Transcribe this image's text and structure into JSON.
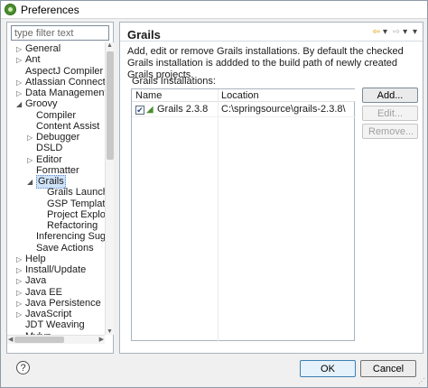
{
  "window": {
    "title": "Preferences",
    "icon": "groovy-green-icon"
  },
  "filter": {
    "placeholder": "type filter text"
  },
  "tree": [
    {
      "label": "General",
      "expanded": false,
      "depth": 0
    },
    {
      "label": "Ant",
      "expanded": false,
      "depth": 0
    },
    {
      "label": "AspectJ Compiler",
      "depth": 0
    },
    {
      "label": "Atlassian Connector",
      "expanded": false,
      "depth": 0
    },
    {
      "label": "Data Management",
      "expanded": false,
      "depth": 0
    },
    {
      "label": "Groovy",
      "expanded": true,
      "depth": 0
    },
    {
      "label": "Compiler",
      "depth": 1
    },
    {
      "label": "Content Assist",
      "depth": 1
    },
    {
      "label": "Debugger",
      "expanded": false,
      "depth": 1
    },
    {
      "label": "DSLD",
      "depth": 1
    },
    {
      "label": "Editor",
      "expanded": false,
      "depth": 1
    },
    {
      "label": "Formatter",
      "depth": 1
    },
    {
      "label": "Grails",
      "expanded": true,
      "selected": true,
      "depth": 1
    },
    {
      "label": "Grails Launch",
      "depth": 2
    },
    {
      "label": "GSP Templates",
      "depth": 2
    },
    {
      "label": "Project Explorer",
      "depth": 2
    },
    {
      "label": "Refactoring",
      "depth": 2
    },
    {
      "label": "Inferencing Suggest",
      "depth": 1
    },
    {
      "label": "Save Actions",
      "depth": 1
    },
    {
      "label": "Help",
      "expanded": false,
      "depth": 0
    },
    {
      "label": "Install/Update",
      "expanded": false,
      "depth": 0
    },
    {
      "label": "Java",
      "expanded": false,
      "depth": 0
    },
    {
      "label": "Java EE",
      "expanded": false,
      "depth": 0
    },
    {
      "label": "Java Persistence",
      "expanded": false,
      "depth": 0
    },
    {
      "label": "JavaScript",
      "expanded": false,
      "depth": 0
    },
    {
      "label": "JDT Weaving",
      "depth": 0
    },
    {
      "label": "Mylyn",
      "expanded": false,
      "depth": 0
    }
  ],
  "page": {
    "title": "Grails",
    "description": "Add, edit or remove Grails installations. By default the checked Grails installation is addded to the build path of newly created Grails projects.",
    "section_label": "Grails Installations:",
    "nav": {
      "back": "⇦",
      "dropdown1": "▾",
      "forward": "⇨",
      "dropdown2": "▾",
      "menu": "▾"
    }
  },
  "table": {
    "columns": [
      "Name",
      "Location"
    ],
    "rows": [
      {
        "checked": true,
        "name": "Grails 2.3.8",
        "location": "C:\\springsource\\grails-2.3.8\\"
      }
    ]
  },
  "side_buttons": {
    "add": "Add...",
    "edit": "Edit...",
    "remove": "Remove..."
  },
  "bottom": {
    "help": "?",
    "ok": "OK",
    "cancel": "Cancel"
  }
}
